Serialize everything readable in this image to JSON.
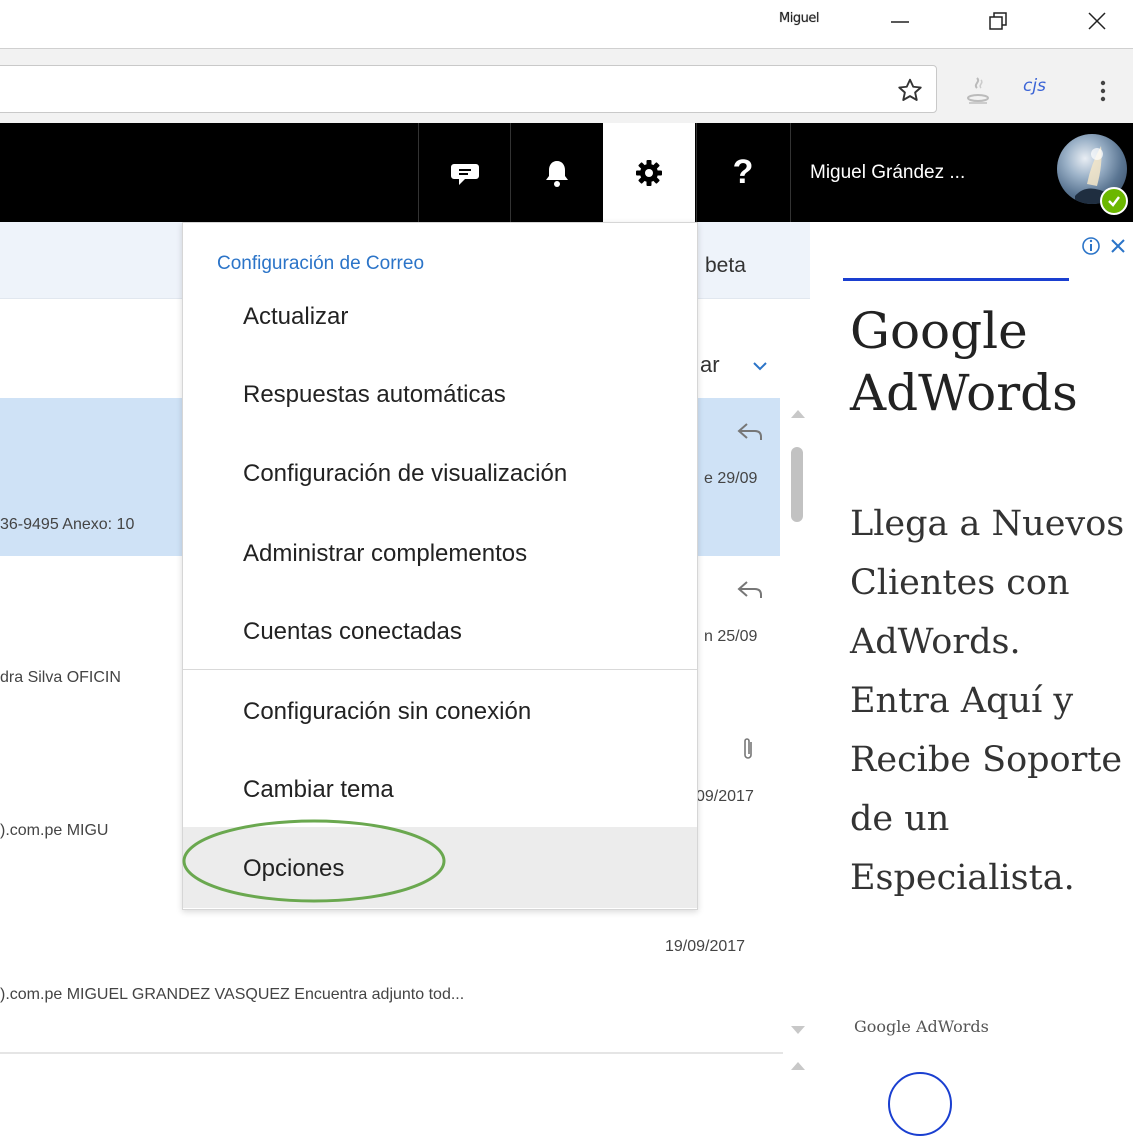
{
  "window": {
    "user_label": "Miguel",
    "minimize_glyph": "—",
    "restore_glyph": "❐",
    "close_glyph": "✕"
  },
  "toolbar": {
    "bookmark_icon": "star-icon",
    "extension_label": "cjs",
    "menu_icon": "chrome-menu-icon"
  },
  "header": {
    "account_name": "Miguel Grández ...",
    "buttons": [
      "feedback-icon",
      "bell-icon",
      "gear-icon",
      "help-icon"
    ],
    "help_glyph": "?",
    "colors": {
      "bar": "#000000",
      "status": "#6bb700"
    }
  },
  "mail": {
    "banner_beta": "beta",
    "filter_label": "ar",
    "rows": [
      {
        "preview": "36-9495 Anexo: 10",
        "date": "e 29/09",
        "icon": "reply-icon"
      },
      {
        "preview": "dra Silva   OFICIN",
        "date": "n 25/09",
        "icon": "reply-icon"
      },
      {
        "preview": ").com.pe     MIGU",
        "date": "09/2017",
        "icon": "paperclip-icon"
      },
      {
        "preview": ").com.pe     MIGUEL GRANDEZ VASQUEZ   Encuentra adjunto tod...",
        "date": "19/09/2017",
        "icon": ""
      }
    ]
  },
  "settings_menu": {
    "heading": "Configuración de Correo",
    "items": [
      "Actualizar",
      "Respuestas automáticas",
      "Configuración de visualización",
      "Administrar complementos",
      "Cuentas conectadas",
      "Configuración sin conexión",
      "Cambiar tema",
      "Opciones"
    ],
    "selected": "Opciones",
    "colors": {
      "heading": "#2b74c8",
      "highlight_ring": "#6aa84f"
    }
  },
  "ad": {
    "title": "Google AdWords",
    "body": "Llega a Nuevos Clientes con AdWords. Entra Aquí y Recibe Soporte de un Especialista.",
    "footer": "Google AdWords",
    "colors": {
      "accent": "#1a3fd0"
    }
  }
}
